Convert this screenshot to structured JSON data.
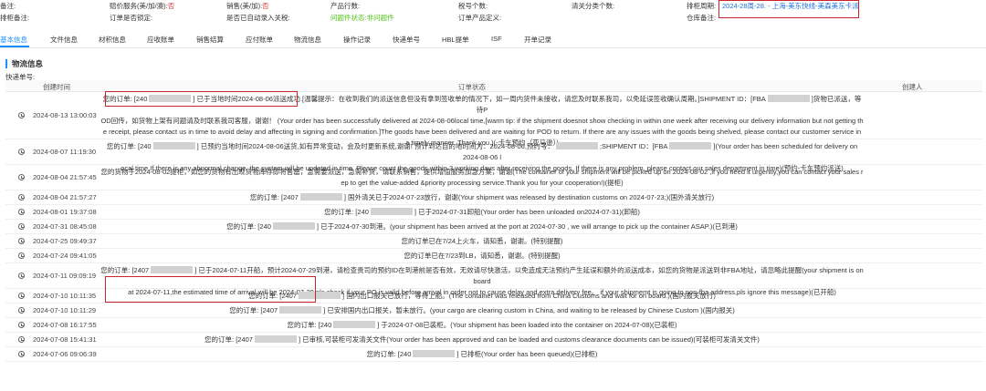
{
  "meta": {
    "row1": {
      "note_label": "备注:",
      "red_service_label": "赔价服务(美/加/澳):",
      "red_service_value": "否",
      "sales_label": "销售(美/加):",
      "sales_value": "否",
      "product_lines_label": "产品行数:",
      "tax_count_label": "税号个数:",
      "customs_class_label": "清关分类个数:",
      "schedule_label": "排柜周期:",
      "schedule_value": "2024-28周-28. - 上海-美东快线-美森美东卡派"
    },
    "row2": {
      "truck_note_label": "排柜备注:",
      "order_sign_label": "订单是否锁定:",
      "auto_join_label": "是否已自动录入关税:",
      "clearance_label": "问题件状态:",
      "clearance_value": "非问题件",
      "product_def_label": "订单产品定义:",
      "warehouse_note_label": "仓库备注:"
    }
  },
  "tabs": [
    {
      "label": "基本信息"
    },
    {
      "label": "文件信息"
    },
    {
      "label": "材积信息"
    },
    {
      "label": "应收账单"
    },
    {
      "label": "销售结算"
    },
    {
      "label": "应付账单"
    },
    {
      "label": "物流信息"
    },
    {
      "label": "操作记录"
    },
    {
      "label": "快递单号"
    },
    {
      "label": "HBL提单"
    },
    {
      "label": "ISF"
    },
    {
      "label": "开单记录"
    }
  ],
  "section": {
    "title": "物流信息",
    "tracking_label": "快递单号:"
  },
  "table": {
    "headers": {
      "time": "创建时间",
      "status": "订单状态",
      "creator": "创建人"
    },
    "rows": [
      {
        "time": "2024-08-13 13:00:03",
        "lines": [
          [
            "您的订单: [240",
            "M",
            "] 已于当地时间2024-08-06派送成功.[温馨提示：在收到我们的派送信息但没有拿到签收单的情况下，如一周内货件未接收，请您及时联系我司，以免延误签收确认周期。]SHIPMENT ID：[FBA",
            "M",
            "]货物已派送，等待P"
          ],
          [
            "OD回传，如货物上架有问题请及时联系我司客服，谢谢！ (Your order has been successfully delivered at 2024-08-06local time,[warm tip: if the shipment doesnot show checking in within one week after receiving our delivery information but not getting th"
          ],
          [
            "e receipt, please contact us in time to avoid delay and affecting in signing and confirmation.]The goods have been delivered and are waiting for POD to return. If there are any issues with the goods being shelved, please contact our customer service in"
          ],
          [
            "a timely manner. Thank you.)(-卡车预约（亚马逊）)"
          ]
        ]
      },
      {
        "time": "2024-08-07 11:19:30",
        "lines": [
          [
            "您的订单: [240",
            "M",
            "] 已预约当地时间2024-08-06送货,如有异常变动，会及时更新系统,谢谢!  预计到达目的地时间为：2024-08-06,预约号：",
            "M",
            ";SHIPMENT ID：[FBA",
            "M",
            "](Your order has been scheduled for delivery on 2024-08-06 l"
          ],
          [
            "ocal time.If there is any abnormal change, the system will be updated in time. Please count the goods within 3 working days after receiving the goods. If there is any problem, please contact our sales department in time)(预约-卡车预约派送)"
          ]
        ]
      },
      {
        "time": "2024-08-04 21:57:45",
        "lines": [
          [
            "您的货物于2024-08-02提柜，如您的货物有出现货物库存即将售罄，急需要派送，急需补货，请联系销售，提供增值服务加急方案，谢谢(The container of your shipment will be picked up on 2024-08-02 ,if you need it urgently,you can contact your sales r"
          ],
          [
            "ep to get the value-added &priority processing service.Thank you for your cooperation!)(提柜)"
          ]
        ]
      },
      {
        "time": "2024-08-04 21:57:27",
        "lines": [
          [
            "您的订单: [2407",
            "M",
            "] 国外清关已于2024-07-23放行，谢谢(Your shipment was released by destination customs on 2024-07-23;)(国外清关放行)"
          ]
        ]
      },
      {
        "time": "2024-08-01 19:37:08",
        "lines": [
          [
            "您的订单: [240",
            "M",
            "] 已于2024-07-31卸船(Your order has been unloaded on2024-07-31)(卸船)"
          ]
        ]
      },
      {
        "time": "2024-07-31 08:45:08",
        "lines": [
          [
            "您的订单: [240",
            "M",
            "] 已于2024-07-30到港。(your shipment has been arrived at the port at 2024-07-30 , we will arrange to pick up the container ASAP.)(已到港)"
          ]
        ]
      },
      {
        "time": "2024-07-25 09:49:37",
        "lines": [
          [
            "您的订单已在7/24上火车，请知悉，谢谢。(特别提醒)"
          ]
        ]
      },
      {
        "time": "2024-07-24 09:41:05",
        "lines": [
          [
            "您的订单已在7/23到LB，请知悉，谢谢。(特别提醒)"
          ]
        ]
      },
      {
        "time": "2024-07-11 09:09:19",
        "lines": [
          [
            "您的订单: [2407",
            "M",
            "] 已于2024-07-11开船，预计2024-07-29到港，请检查贵司的预约ID在到港前是否有效，无效请尽快激活，以免造成无法预约产生延误和额外的派送成本，如您的货物是派送到非FBA地址，请忽略此提醒(your shipment is on board"
          ],
          [
            "at 2024-07-11,the estimated time of arrival will be 2024-07-29,pls check if your PO is valid before arrival in order not to cause delay and extra delivery fee。 if your shipmemt is going to non-fba address,pls ignore this message)(已开船)"
          ]
        ]
      },
      {
        "time": "2024-07-10 10:11:35",
        "lines": [
          [
            "您的订单: [2407",
            "M",
            "] 国内出口报关已放行，等待上船。(The container was released from China Customs and wait for on board.)(国内报关放行)"
          ]
        ]
      },
      {
        "time": "2024-07-10 10:11:29",
        "lines": [
          [
            "您的订单: [2407",
            "M",
            "] 已安排国内出口报关，暂未放行。(your cargo are clearing custom in China, and waiting to be released by Chinese Custom )(国内报关)"
          ]
        ]
      },
      {
        "time": "2024-07-08 16:17:55",
        "lines": [
          [
            "您的订单: [240",
            "M",
            "] 于2024-07-08已装柜。(Your shipment has been loaded into the container on 2024-07-08)(已装柜)"
          ]
        ]
      },
      {
        "time": "2024-07-08 15:41:31",
        "lines": [
          [
            "您的订单: [2407",
            "M",
            "] 已审核,可装柜可发清关文件(Your order has been approved and can be loaded and customs clearance documents can be issued)(可装柜可发清关文件)"
          ]
        ]
      },
      {
        "time": "2024-07-06 09:06:39",
        "lines": [
          [
            "您的订单: [240",
            "M",
            "] 已排柜(Your order has been queued)(已排柜)"
          ]
        ]
      }
    ]
  }
}
